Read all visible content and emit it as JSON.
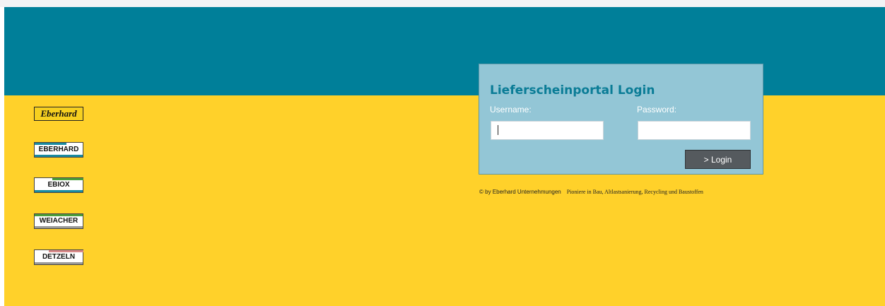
{
  "colors": {
    "banner": "#007f99",
    "background": "#ffd12a",
    "login_box": "#93c6d6",
    "title": "#0a7c96",
    "button": "#555a5e"
  },
  "logos": [
    {
      "label": "Eberhard",
      "style": "script"
    },
    {
      "label": "EBERHARD",
      "stripe_top": "#1a8aa0",
      "stripe_bottom": "#1a8aa0"
    },
    {
      "label": "EBIOX",
      "stripe_top": "#4a9e3a",
      "stripe_bottom": "#1a8aa0"
    },
    {
      "label": "WEIACHER",
      "stripe_top": "#4a9e3a",
      "stripe_bottom": "#9a9a9a"
    },
    {
      "label": "DETZELN",
      "stripe_top": "#d98a8a",
      "stripe_bottom": "#9a9a9a"
    }
  ],
  "login": {
    "title": "Lieferscheinportal Login",
    "username_label": "Username:",
    "username_value": "",
    "password_label": "Password:",
    "password_value": "",
    "button_label": "> Login"
  },
  "footer": {
    "copyright": "© by Eberhard Unternehmungen",
    "slogan": "Pioniere in Bau, Altlastsanierung, Recycling und Baustoffen"
  }
}
